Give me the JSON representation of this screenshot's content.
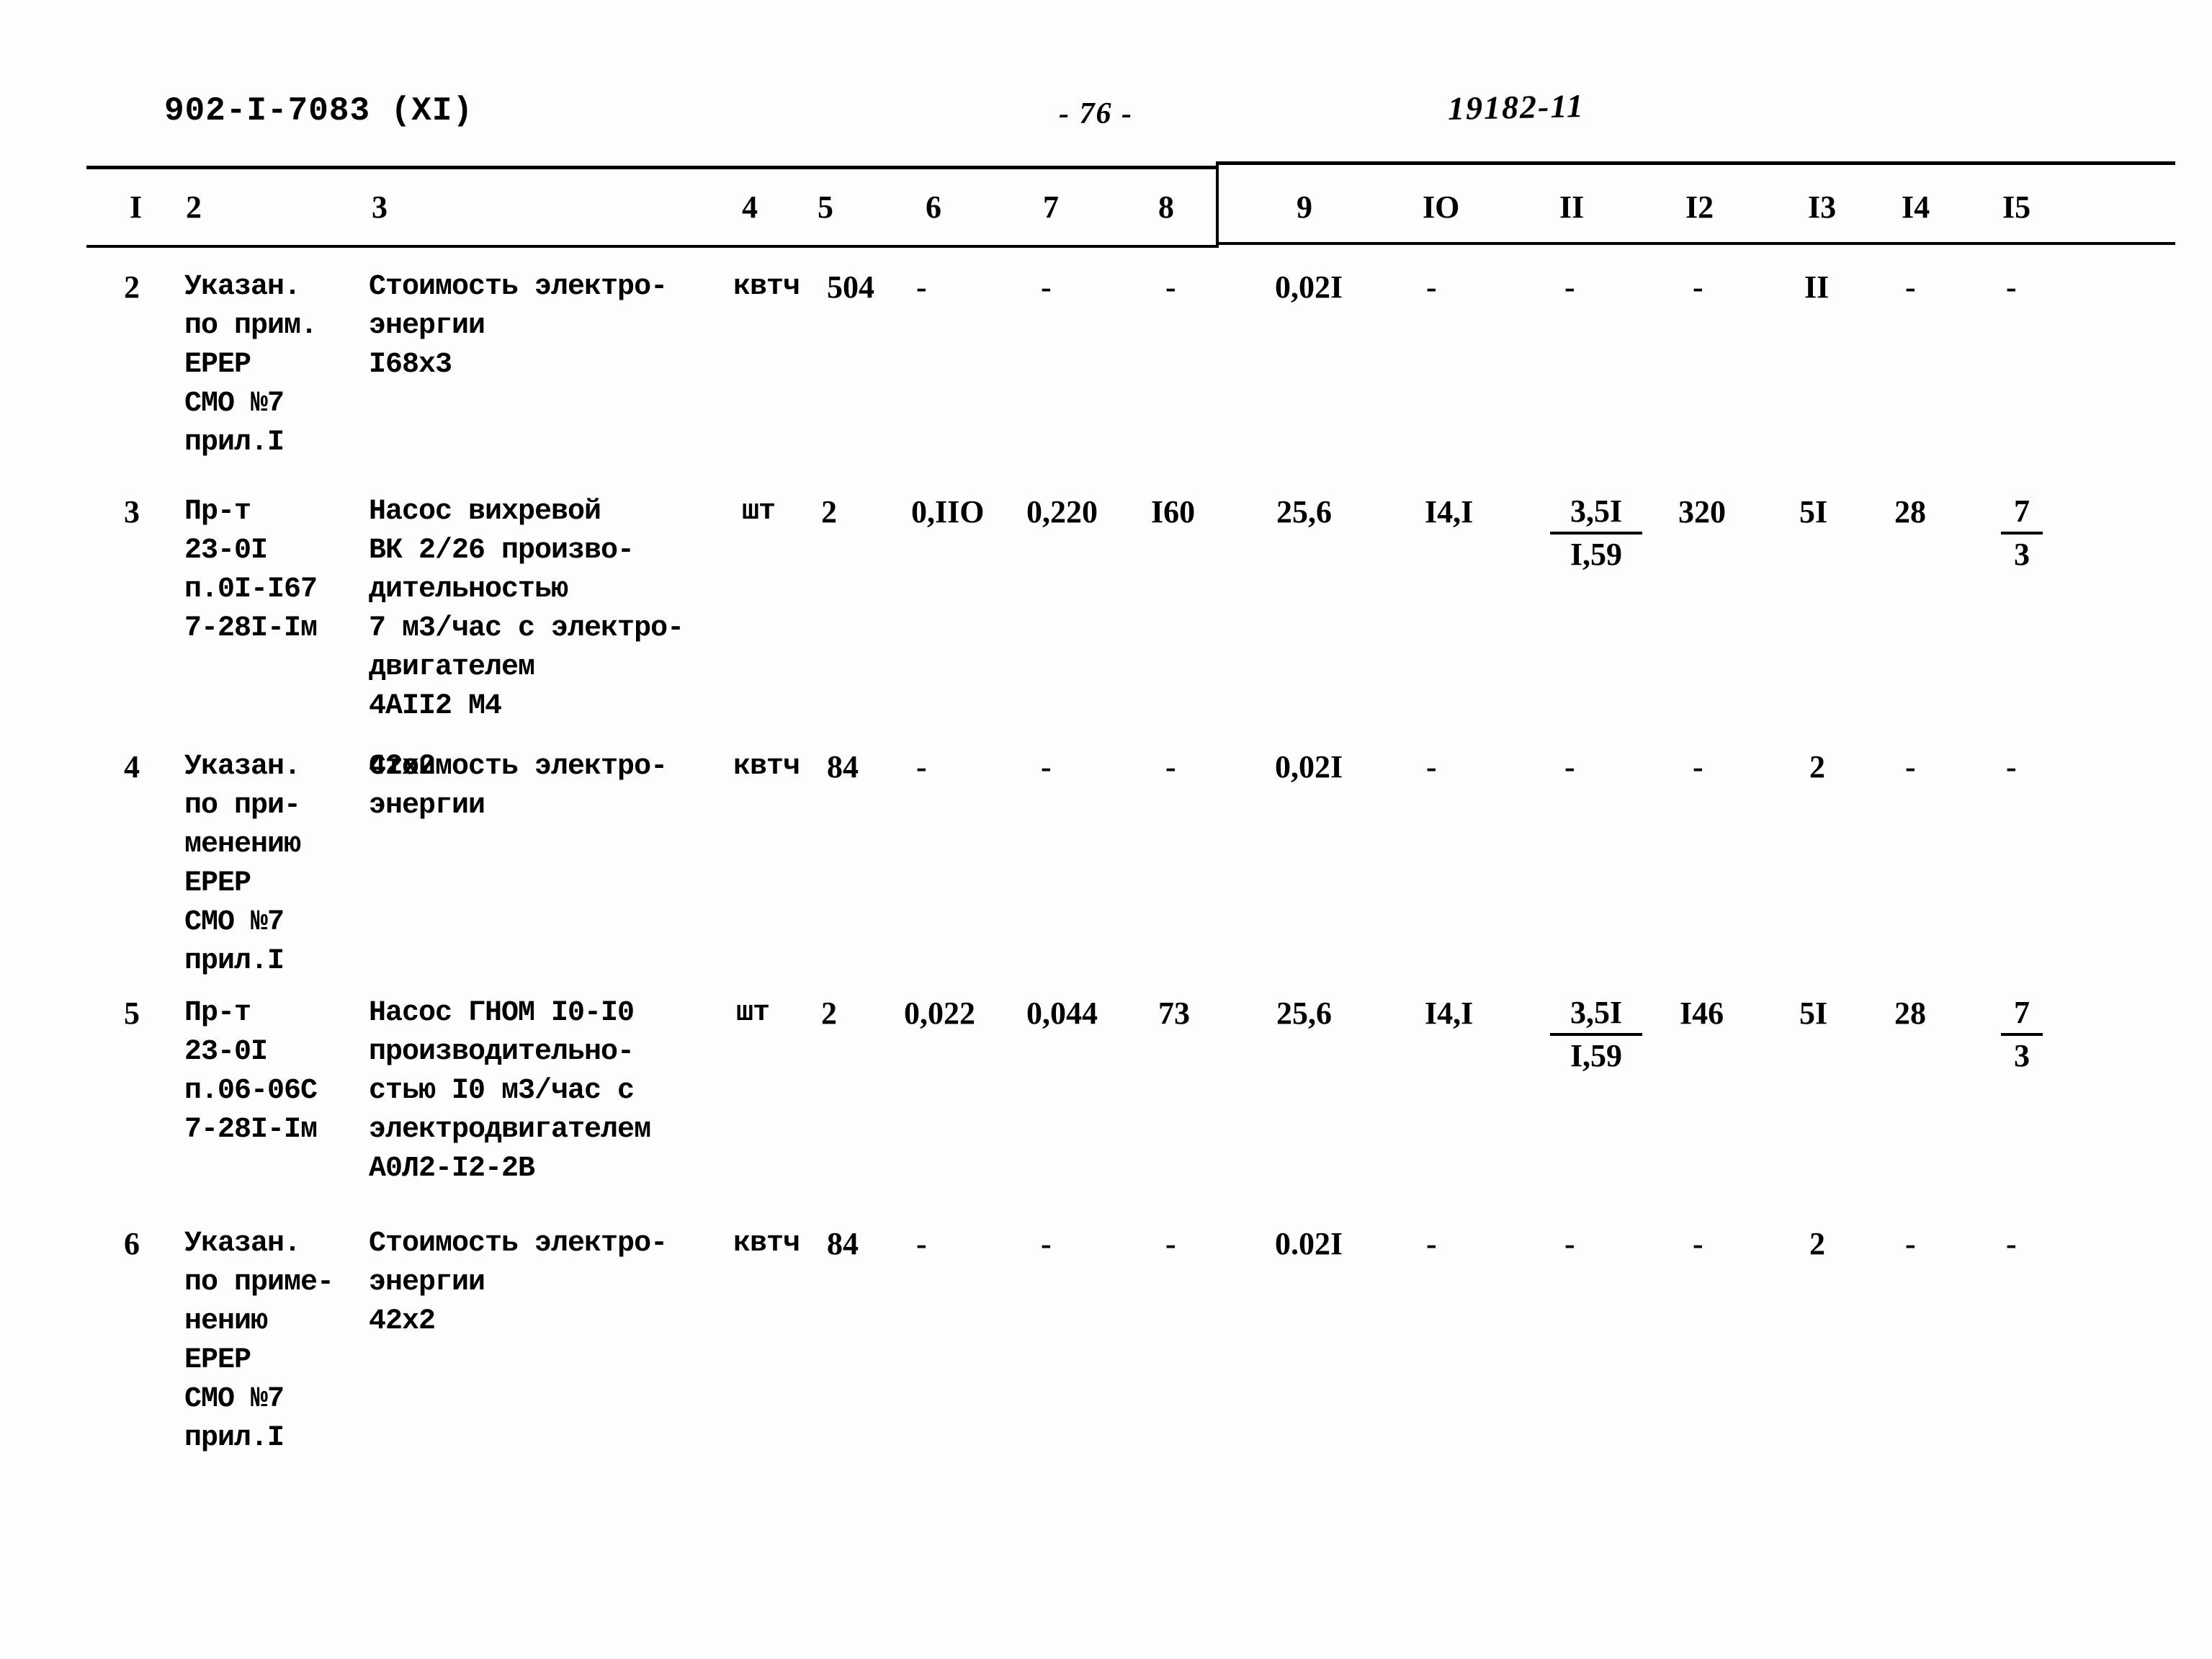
{
  "header": {
    "doc_code": "902-I-7083 (XI)",
    "page_number": "- 76 -",
    "handwritten_note": "19182-11"
  },
  "table": {
    "column_headers": [
      "I",
      "2",
      "3",
      "4",
      "5",
      "6",
      "7",
      "8",
      "9",
      "IO",
      "II",
      "I2",
      "I3",
      "I4",
      "I5"
    ],
    "rows": [
      {
        "index": "2",
        "reference": "Указан.\nпо прим.\nЕРЕР\nСМО №7\nприл.I",
        "description": "Стоимость электро-\nэнергии\nI68x3",
        "unit": "квтч",
        "c5": "504",
        "c6": "-",
        "c7": "-",
        "c8": "-",
        "c9": "0,02I",
        "c10": "-",
        "c11": "-",
        "c12": "-",
        "c13": "II",
        "c14": "-",
        "c15": "-"
      },
      {
        "index": "3",
        "reference": "Пр-т\n23-0I\nп.0I-I67\n7-28I-Iм",
        "description": "Насос вихревой\nВК 2/26 произво-\nдительностью\n7 м3/час с электро-\nдвигателем\n4АII2 М4",
        "unit": "шт",
        "c5": "2",
        "c6": "0,IIO",
        "c7": "0,220",
        "c8": "I60",
        "c9": "25,6",
        "c10": "I4,I",
        "c11_top": "3,5I",
        "c11_bot": "I,59",
        "c12": "320",
        "c13": "5I",
        "c14": "28",
        "c15_top": "7",
        "c15_bot": "3"
      },
      {
        "index": "4",
        "reference": "Указан.\nпо при-\nменению\nЕРЕР\nСМО №7\nприл.I",
        "description": "Стоимость электро-\nэнергии",
        "description2": "42x2",
        "unit": "квтч",
        "c5": "84",
        "c6": "-",
        "c7": "-",
        "c8": "-",
        "c9": "0,02I",
        "c10": "-",
        "c11": "-",
        "c12": "-",
        "c13": "2",
        "c14": "-",
        "c15": "-"
      },
      {
        "index": "5",
        "reference": "Пр-т\n23-0I\nп.06-06С\n7-28I-Iм",
        "description": "Насос ГНОМ I0-I0\nпроизводительно-\nстью I0 м3/час с\nэлектродвигателем\nА0Л2-I2-2В",
        "unit": "шт",
        "c5": "2",
        "c6": "0,022",
        "c7": "0,044",
        "c8": "73",
        "c9": "25,6",
        "c10": "I4,I",
        "c11_top": "3,5I",
        "c11_bot": "I,59",
        "c12": "I46",
        "c13": "5I",
        "c14": "28",
        "c15_top": "7",
        "c15_bot": "3"
      },
      {
        "index": "6",
        "reference": "Указан.\nпо приме-\nнению\nЕРЕР\nСМО №7\nприл.I",
        "description": "Стоимость электро-\nэнергии\n42x2",
        "unit": "квтч",
        "c5": "84",
        "c6": "-",
        "c7": "-",
        "c8": "-",
        "c9": "0.02I",
        "c10": "-",
        "c11": "-",
        "c12": "-",
        "c13": "2",
        "c14": "-",
        "c15": "-"
      }
    ]
  }
}
